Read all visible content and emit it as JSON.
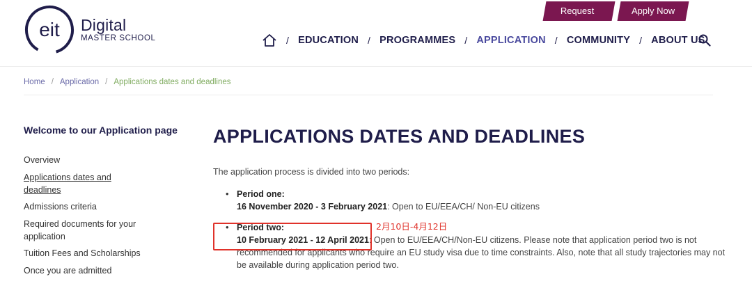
{
  "header": {
    "logo": {
      "mark": "eit",
      "line1": "Digital",
      "line2": "MASTER SCHOOL"
    },
    "top_buttons": {
      "request_info": "Request Info",
      "apply_now": "Apply Now"
    },
    "nav": {
      "separator": "/",
      "items": [
        "EDUCATION",
        "PROGRAMMES",
        "APPLICATION",
        "COMMUNITY",
        "ABOUT US"
      ],
      "active": "APPLICATION"
    }
  },
  "breadcrumb": {
    "items": [
      "Home",
      "Application",
      "Applications dates and deadlines"
    ],
    "separator": "/"
  },
  "sidebar": {
    "title": "Welcome to our Application page",
    "items": [
      "Overview",
      "Applications dates and deadlines",
      "Admissions criteria",
      "Required documents for your application",
      "Tuition Fees and Scholarships",
      "Once you are admitted"
    ]
  },
  "main": {
    "title": "APPLICATIONS DATES AND DEADLINES",
    "intro": "The application process is divided into two periods:",
    "periods": [
      {
        "label": "Period one:",
        "dates": "16 November 2020 - 3 February 2021",
        "text": ": Open to EU/EEA/CH/ Non-EU citizens"
      },
      {
        "label": "Period two:",
        "dates": "10 February 2021 - 12 April 2021",
        "text": ": Open to EU/EEA/CH/Non-EU citizens. Please note that application period two is not recommended for applicants who require an EU study visa due to time constraints. Also, note that all study trajectories may not be available during application period two."
      }
    ],
    "annotation": "2月10日-4月12日"
  },
  "colors": {
    "brand_navy": "#1f1d4a",
    "button_maroon": "#7b1750",
    "breadcrumb_green": "#7fab5f",
    "annotation_red": "#e0322a"
  }
}
